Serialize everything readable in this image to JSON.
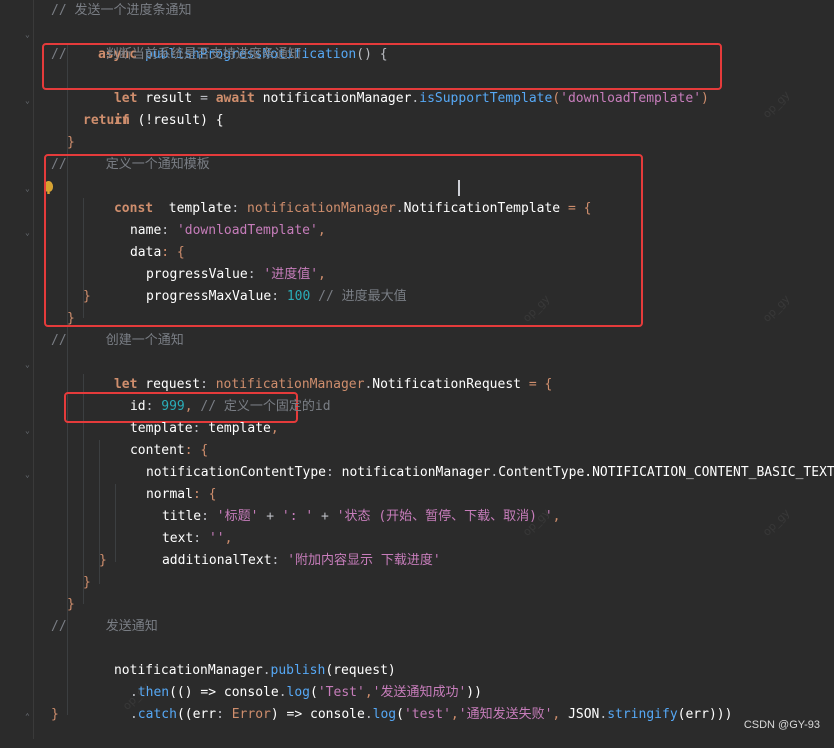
{
  "code": {
    "line1": "// 发送一个进度条通知",
    "line2_kw": "async ",
    "line2_fn": "publishProgressNotification",
    "line2_tail": "() {",
    "line3": "//     判断当前系统是否支持进度条通知",
    "line4_kw": "let ",
    "line4_var": "result ",
    "line4_eq": "= ",
    "line4_await": "await ",
    "line4_obj": "notificationManager",
    "line4_dot": ".",
    "line4_method": "isSupportTemplate",
    "line4_paren1": "(",
    "line4_str": "'downloadTemplate'",
    "line4_paren2": ")",
    "line5_kw": "if ",
    "line5_text": "(!result) {",
    "line6": "return",
    "line7": "}",
    "line8": "//     定义一个通知模板",
    "line9_kw": "const  ",
    "line9_var": "template",
    "line9_colon": ": ",
    "line9_ns": "notificationManager",
    "line9_dot": ".",
    "line9_type1": "Notification",
    "line9_type2": "Template",
    "line9_tail": " = {",
    "line10_key": "name",
    "line10_colon": ": ",
    "line10_str": "'downloadTemplate'",
    "line10_comma": ",",
    "line11_key": "data",
    "line11_tail": ": {",
    "line12_key": "progressValue",
    "line12_colon": ": ",
    "line12_str": "'进度值'",
    "line12_comma": ",",
    "line13_key": "progressMaxValue",
    "line13_colon": ": ",
    "line13_num": "100 ",
    "line13_cmt": "// 进度最大值",
    "line14": "}",
    "line15": "}",
    "line16": "//     创建一个通知",
    "line17_kw": "let ",
    "line17_var": "request",
    "line17_colon": ": ",
    "line17_ns": "notificationManager",
    "line17_dot": ".",
    "line17_type": "NotificationRequest",
    "line17_tail": " = {",
    "line18_key": "id",
    "line18_colon": ": ",
    "line18_num": "999",
    "line18_comma": ", ",
    "line18_cmt": "// 定义一个固定的id",
    "line19_key": "template",
    "line19_colon": ": ",
    "line19_val": "template",
    "line19_comma": ",",
    "line20_key": "content",
    "line20_tail": ": {",
    "line21_key": "notificationContentType",
    "line21_colon": ": ",
    "line21_ns": "notificationManager",
    "line21_dot": ".",
    "line21_rest": "ContentType.NOTIFICATION_CONTENT_BASIC_TEXT,",
    "line22_key": "normal",
    "line22_tail": ": {",
    "line23_key": "title",
    "line23_colon": ": ",
    "line23_str1": "'标题' ",
    "line23_plus1": "+ ",
    "line23_str2": "': ' ",
    "line23_plus2": "+ ",
    "line23_str3": "'状态 (开始、暂停、下载、取消) '",
    "line23_comma": ",",
    "line24_key": "text",
    "line24_colon": ": ",
    "line24_str": "''",
    "line24_comma": ",",
    "line25_key": "additionalText",
    "line25_colon": ": ",
    "line25_str": "'附加内容显示 下载进度'",
    "line26": "}",
    "line27": "}",
    "line28": "}",
    "line29": "//     发送通知",
    "line30_obj": "notificationManager",
    "line30_dot": ".",
    "line30_fn": "publish",
    "line30_tail": "(request)",
    "line31_dot": ".",
    "line31_fn": "then",
    "line31_mid": "(() => ",
    "line31_console": "console",
    "line31_dot2": ".",
    "line31_log": "log",
    "line31_open": "(",
    "line31_str1": "'Test'",
    "line31_comma": ",",
    "line31_str2": "'发送通知成功'",
    "line31_close": "))",
    "line32_dot": ".",
    "line32_fn": "catch",
    "line32_open": "((",
    "line32_err": "err",
    "line32_colon": ": ",
    "line32_type": "Error",
    "line32_arrow": ") => ",
    "line32_console": "console",
    "line32_dot2": ".",
    "line32_log": "log",
    "line32_open2": "(",
    "line32_str1": "'test'",
    "line32_comma1": ",",
    "line32_str2": "'通知发送失败'",
    "line32_comma2": ", ",
    "line32_json": "JSON",
    "line32_dot3": ".",
    "line32_stringify": "stringify",
    "line32_tail": "(err)))",
    "line33": "}"
  },
  "footer": {
    "credit": "CSDN @GY-93"
  },
  "watermarks": {
    "text": "op_gy"
  },
  "icons": {
    "bulb": "lightbulb-icon",
    "fold": "fold-marker-icon",
    "caret": "text-caret-icon"
  },
  "colors": {
    "background": "#2b2b2b",
    "highlight": "#e53b3b",
    "comment": "#7a7e85",
    "keyword": "#cf8e6d",
    "function": "#56a8f5",
    "string": "#6aab73",
    "property": "#c77dbb",
    "number": "#2aacb8"
  }
}
